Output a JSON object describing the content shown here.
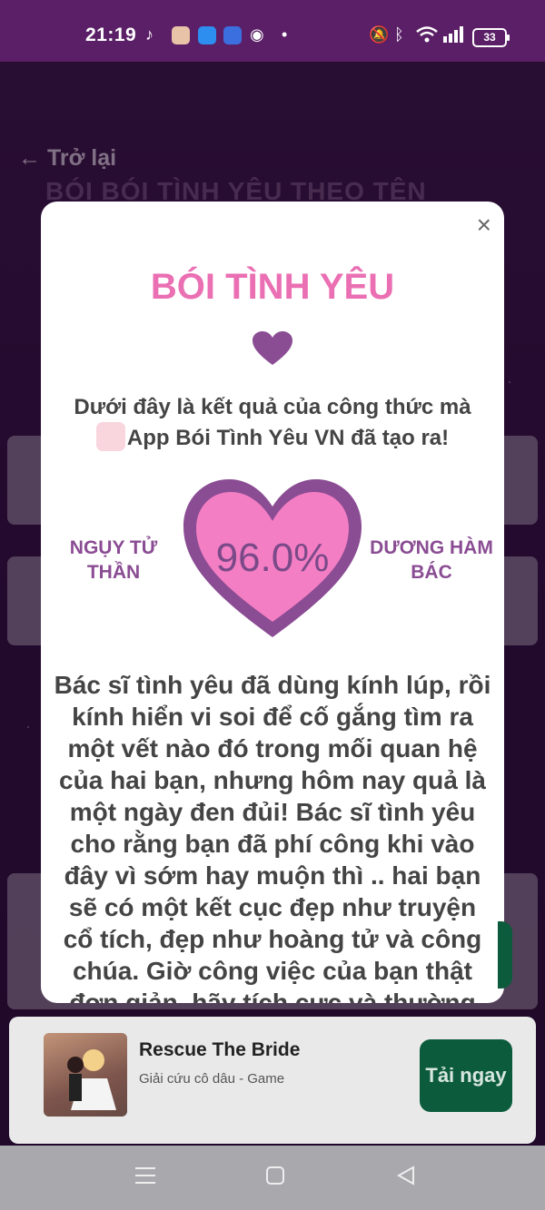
{
  "status_bar": {
    "time": "21:19",
    "battery": "33",
    "icons": [
      "tiktok-icon",
      "app-icon",
      "app-icon",
      "app-icon",
      "app-icon",
      "dot-icon",
      "mute-icon",
      "bluetooth-icon",
      "wifi-icon",
      "signal-icon"
    ]
  },
  "background": {
    "back_label": "Trở lại",
    "title_partial": "BÓI BÓI TÌNH YÊU THEO TÊN"
  },
  "modal": {
    "close_glyph": "×",
    "title": "BÓI TÌNH YÊU",
    "intro_line1": "Dưới đây là kết quả của công thức mà",
    "intro_line2": "App Bói Tình Yêu VN đã tạo ra!",
    "name_left": "NGỤY TỬ THẦN",
    "name_right": "DƯƠNG HÀM BÁC",
    "percent": "96.0%",
    "result_text": "Bác sĩ tình yêu đã dùng kính lúp, rồi kính hiển vi soi để cố gắng tìm ra một vết nào đó trong mối quan hệ của hai bạn, nhưng hôm nay quả là một ngày đen đủi! Bác sĩ tình yêu cho rằng bạn đã phí công khi vào đây vì sớm hay muộn thì .. hai bạn sẽ có một kết cục đẹp như truyện cổ tích, đẹp như hoàng tử và công chúa. Giờ công việc của bạn thật đơn giản, hãy tích cực và thường"
  },
  "ad": {
    "title": "Rescue The Bride",
    "subtitle": "Giải cứu cô dâu - Game",
    "button": "Tải ngay"
  },
  "colors": {
    "accent_pink": "#ea6fb3",
    "heart_outer": "#8a4c93",
    "heart_inner": "#f47ec4",
    "install_green": "#0c5b3c"
  }
}
